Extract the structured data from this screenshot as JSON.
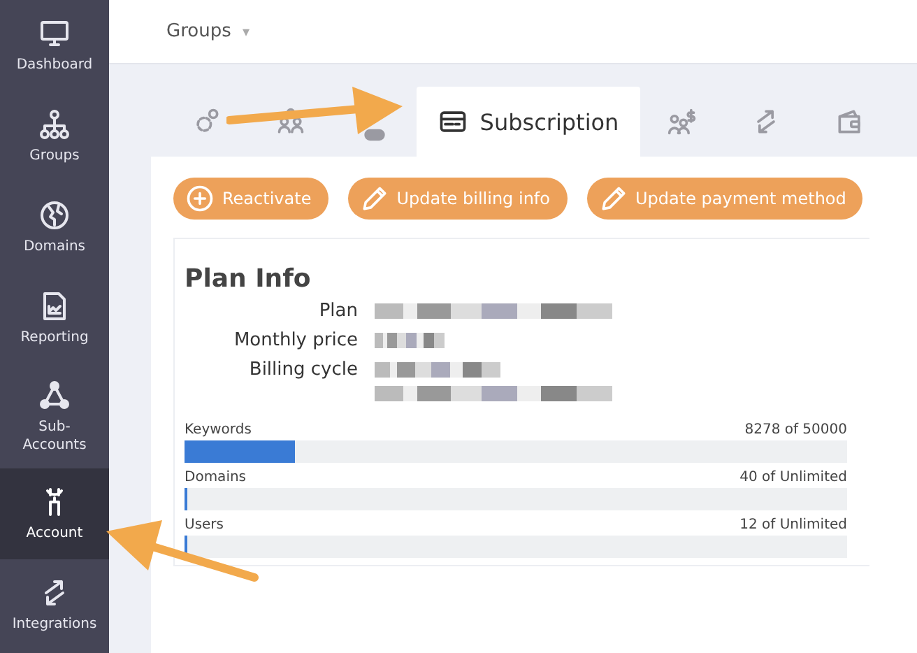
{
  "sidebar": {
    "items": [
      {
        "label": "Dashboard",
        "selected": false
      },
      {
        "label": "Groups",
        "selected": false
      },
      {
        "label": "Domains",
        "selected": false
      },
      {
        "label": "Reporting",
        "selected": false
      },
      {
        "label": "Sub-\nAccounts",
        "selected": false
      },
      {
        "label": "Account",
        "selected": true
      },
      {
        "label": "Integrations",
        "selected": false
      }
    ]
  },
  "breadcrumb": {
    "label": "Groups",
    "caret": "▾"
  },
  "tabs": [
    {
      "selected": false
    },
    {
      "selected": false
    },
    {
      "selected": false
    },
    {
      "label": "Subscription",
      "selected": true
    },
    {
      "selected": false
    },
    {
      "selected": false
    },
    {
      "selected": false
    }
  ],
  "actions": [
    {
      "label": "Reactivate",
      "kind": "add"
    },
    {
      "label": "Update billing info",
      "kind": "edit"
    },
    {
      "label": "Update payment method",
      "kind": "edit"
    }
  ],
  "plan_info": {
    "title": "Plan Info",
    "fields": [
      {
        "label": "Plan",
        "values": [
          {
            "kind": "redacted"
          }
        ]
      },
      {
        "label": "Monthly price",
        "values": [
          {
            "kind": "redacted"
          }
        ]
      },
      {
        "label": "Billing cycle",
        "values": [
          {
            "kind": "redacted"
          },
          {
            "kind": "redacted"
          }
        ]
      }
    ]
  },
  "usage": [
    {
      "name": "Keywords",
      "reading": "8278 of 50000",
      "level": 0.166
    },
    {
      "name": "Domains",
      "reading": "40 of Unlimited",
      "level": 0.005
    },
    {
      "name": "Users",
      "reading": "12 of Unlimited",
      "level": 0.004
    }
  ]
}
